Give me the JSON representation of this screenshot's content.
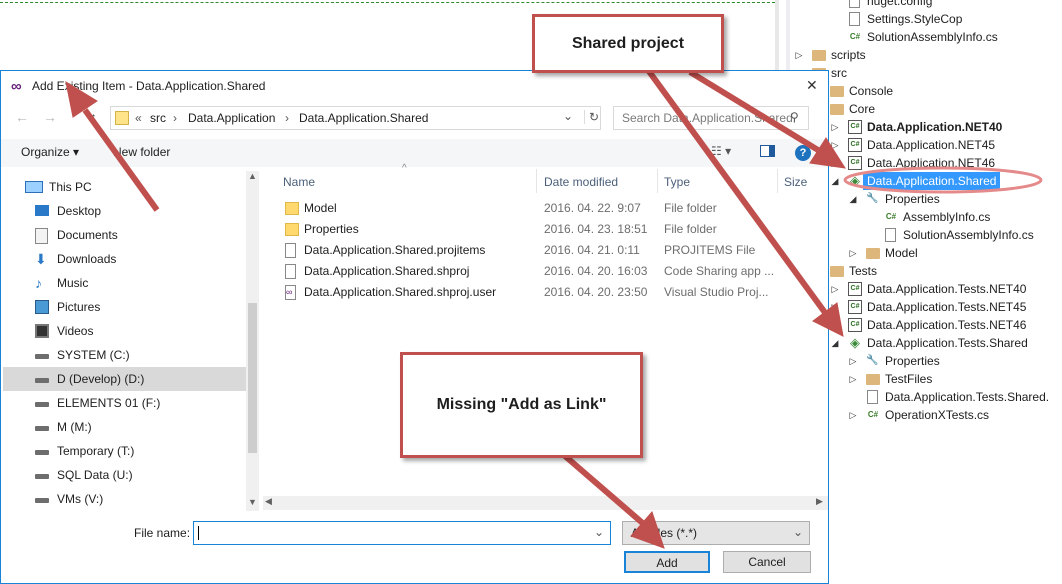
{
  "solution_explorer": {
    "rows": [
      {
        "label": "nuget.config",
        "indent": 3,
        "icon": "file-icon"
      },
      {
        "label": "Settings.StyleCop",
        "indent": 3,
        "icon": "file-icon"
      },
      {
        "label": "SolutionAssemblyInfo.cs",
        "indent": 3,
        "icon": "cs-file-icon"
      },
      {
        "label": "scripts",
        "indent": 1,
        "icon": "folder-icon",
        "arrow": "▷"
      },
      {
        "label": "src",
        "indent": 1,
        "icon": "folder-icon",
        "arrow": "◢"
      },
      {
        "label": "Console",
        "indent": 2,
        "icon": "folder-icon",
        "arrow": "▷"
      },
      {
        "label": "Core",
        "indent": 2,
        "icon": "folder-icon",
        "arrow": "◢"
      },
      {
        "label": "Data.Application.NET40",
        "indent": 3,
        "icon": "csproj-icon",
        "arrow": "▷",
        "bold": true
      },
      {
        "label": "Data.Application.NET45",
        "indent": 3,
        "icon": "csproj-icon",
        "arrow": "▷"
      },
      {
        "label": "Data.Application.NET46",
        "indent": 3,
        "icon": "csproj-icon",
        "arrow": "▷"
      },
      {
        "label": "Data.Application.Shared",
        "indent": 3,
        "icon": "shared-project-icon",
        "arrow": "◢",
        "selected": true
      },
      {
        "label": "Properties",
        "indent": 4,
        "icon": "wrench-icon",
        "arrow": "◢"
      },
      {
        "label": "AssemblyInfo.cs",
        "indent": 5,
        "icon": "cs-file-icon"
      },
      {
        "label": "SolutionAssemblyInfo.cs",
        "indent": 5,
        "icon": "file-icon"
      },
      {
        "label": "Model",
        "indent": 4,
        "icon": "folder-icon",
        "arrow": "▷"
      },
      {
        "label": "Tests",
        "indent": 2,
        "icon": "folder-icon",
        "arrow": "◢"
      },
      {
        "label": "Data.Application.Tests.NET40",
        "indent": 3,
        "icon": "csproj-icon",
        "arrow": "▷"
      },
      {
        "label": "Data.Application.Tests.NET45",
        "indent": 3,
        "icon": "csproj-icon",
        "arrow": "▷"
      },
      {
        "label": "Data.Application.Tests.NET46",
        "indent": 3,
        "icon": "csproj-icon",
        "arrow": "▷"
      },
      {
        "label": "Data.Application.Tests.Shared",
        "indent": 3,
        "icon": "shared-project-icon",
        "arrow": "◢"
      },
      {
        "label": "Properties",
        "indent": 4,
        "icon": "wrench-icon",
        "arrow": "▷"
      },
      {
        "label": "TestFiles",
        "indent": 4,
        "icon": "folder-icon",
        "arrow": "▷"
      },
      {
        "label": "Data.Application.Tests.Shared.",
        "indent": 4,
        "icon": "file-icon"
      },
      {
        "label": "OperationXTests.cs",
        "indent": 4,
        "icon": "cs-file-icon",
        "arrow": "▷"
      }
    ]
  },
  "dialog": {
    "title": "Add Existing Item - Data.Application.Shared",
    "close_glyph": "✕",
    "breadcrumb": {
      "prefix": "«",
      "parts": [
        "src",
        "Data.Application",
        "Data.Application.Shared"
      ]
    },
    "search_placeholder": "Search Data.Application.Shared",
    "toolbar": {
      "organize": "Organize ▾",
      "new_folder": "New folder"
    },
    "nav_items": [
      {
        "label": "This PC",
        "icon": "pc-icon"
      },
      {
        "label": "Desktop",
        "icon": "desktop-icon"
      },
      {
        "label": "Documents",
        "icon": "documents-icon"
      },
      {
        "label": "Downloads",
        "icon": "downloads-icon"
      },
      {
        "label": "Music",
        "icon": "music-icon"
      },
      {
        "label": "Pictures",
        "icon": "pictures-icon"
      },
      {
        "label": "Videos",
        "icon": "videos-icon"
      },
      {
        "label": "SYSTEM (C:)",
        "icon": "drive-icon"
      },
      {
        "label": "D (Develop) (D:)",
        "icon": "drive-icon",
        "selected": true
      },
      {
        "label": "ELEMENTS 01 (F:)",
        "icon": "drive-icon"
      },
      {
        "label": "M (M:)",
        "icon": "drive-icon"
      },
      {
        "label": "Temporary (T:)",
        "icon": "drive-icon"
      },
      {
        "label": "SQL Data (U:)",
        "icon": "drive-icon"
      },
      {
        "label": "VMs (V:)",
        "icon": "drive-icon"
      }
    ],
    "columns": [
      "Name",
      "Date modified",
      "Type",
      "Size"
    ],
    "files": [
      {
        "name": "Model",
        "date": "2016. 04. 22. 9:07",
        "type": "File folder",
        "icon": "folder-icon"
      },
      {
        "name": "Properties",
        "date": "2016. 04. 23. 18:51",
        "type": "File folder",
        "icon": "folder-icon"
      },
      {
        "name": "Data.Application.Shared.projitems",
        "date": "2016. 04. 21. 0:11",
        "type": "PROJITEMS File",
        "icon": "file-icon"
      },
      {
        "name": "Data.Application.Shared.shproj",
        "date": "2016. 04. 20. 16:03",
        "type": "Code Sharing app ...",
        "icon": "file-icon"
      },
      {
        "name": "Data.Application.Shared.shproj.user",
        "date": "2016. 04. 20. 23:50",
        "type": "Visual Studio Proj...",
        "icon": "vs-file-icon"
      }
    ],
    "file_name_label": "File name:",
    "file_name_value": "",
    "filter_value": "All Files (*.*)",
    "add_button": "Add",
    "cancel_button": "Cancel"
  },
  "callouts": {
    "shared_project": "Shared project",
    "missing_link": "Missing \"Add as Link\""
  },
  "colors": {
    "callout_border": "#c0504d",
    "selection": "#3399ff",
    "nav_selected": "#d9d9d9",
    "dialog_border": "#1883d7"
  }
}
